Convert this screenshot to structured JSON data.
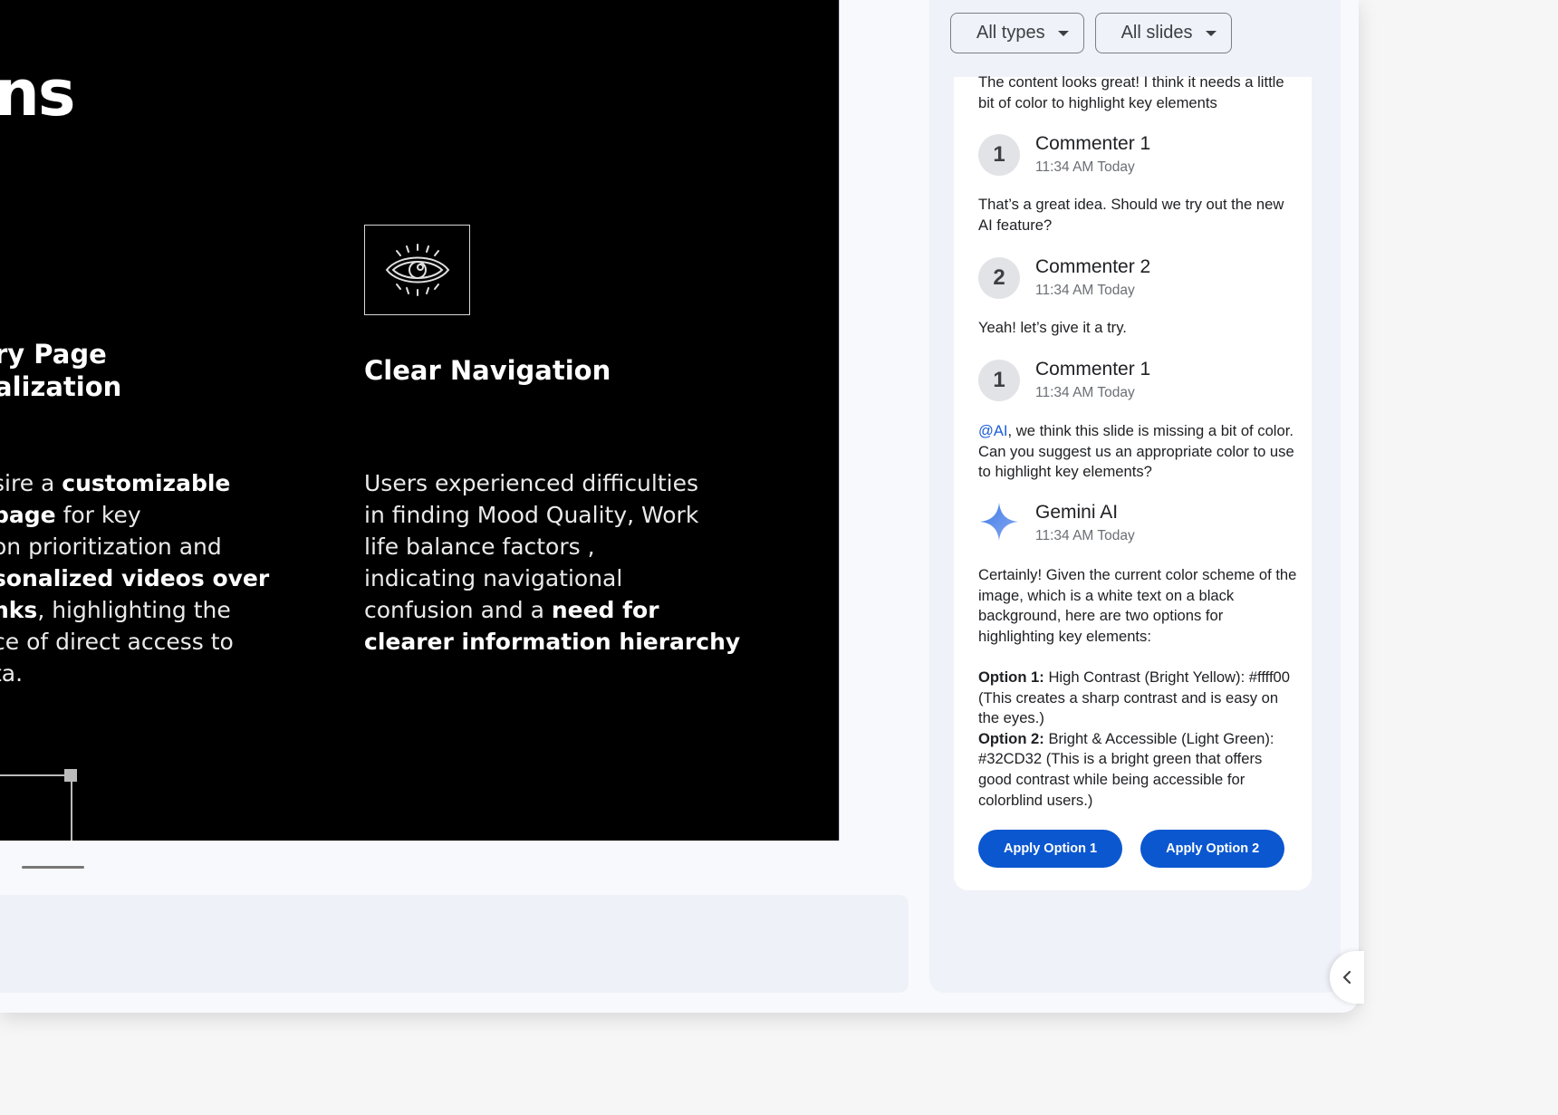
{
  "slide": {
    "title_fragment": "ns",
    "left_feature": {
      "heading_lines": [
        "ry Page",
        "alization"
      ],
      "body_lines": [
        [
          {
            "t": "sire a ",
            "b": false
          },
          {
            "t": "customizable",
            "b": true
          }
        ],
        [
          {
            "t": "page",
            "b": true
          },
          {
            "t": " for key",
            "b": false
          }
        ],
        [
          {
            "t": "on prioritization and",
            "b": false
          }
        ],
        [
          {
            "t": "sonalized videos over",
            "b": true
          }
        ],
        [
          {
            "t": "nks",
            "b": true
          },
          {
            "t": ", highlighting the",
            "b": false
          }
        ],
        [
          {
            "t": "ce of direct access to",
            "b": false
          }
        ],
        [
          {
            "t": "ta.",
            "b": false
          }
        ]
      ]
    },
    "right_feature": {
      "icon": "eye-icon",
      "heading": "Clear Navigation",
      "body_lines": [
        [
          {
            "t": "Users experienced difficulties",
            "b": false
          }
        ],
        [
          {
            "t": "in finding Mood Quality, Work",
            "b": false
          }
        ],
        [
          {
            "t": "life balance factors ,",
            "b": false
          }
        ],
        [
          {
            "t": "indicating navigational",
            "b": false
          }
        ],
        [
          {
            "t": "confusion and a ",
            "b": false
          },
          {
            "t": "need for",
            "b": true
          }
        ],
        [
          {
            "t": "clearer information hierarchy",
            "b": true
          }
        ]
      ]
    }
  },
  "comments_panel": {
    "filters": {
      "types": "All types",
      "slides": "All slides"
    },
    "thread": {
      "first_message": "The content looks great! I think it needs a little bit of color to highlight key elements",
      "entries": [
        {
          "avatar": "1",
          "author": "Commenter 1",
          "time": "11:34 AM Today",
          "message": "That’s a great idea. Should we try out the new AI feature?"
        },
        {
          "avatar": "2",
          "author": "Commenter 2",
          "time": "11:34 AM Today",
          "message": "Yeah! let’s give it a try."
        },
        {
          "avatar": "1",
          "author": "Commenter 1",
          "time": "11:34 AM Today",
          "mention": "@AI",
          "message": ", we think this slide is missing a bit of color. Can you suggest us an appropriate color to use to highlight key elements?"
        }
      ],
      "ai": {
        "author": "Gemini AI",
        "time": "11:34 AM Today",
        "intro": "Certainly! Given the current color scheme of the image, which is a white text on a black background, here are two options for highlighting key elements:",
        "option1_label": "Option 1:",
        "option1_text": " High Contrast (Bright Yellow): #ffff00 (This creates a sharp contrast and is easy on the eyes.)",
        "option2_label": "Option 2:",
        "option2_text": " Bright & Accessible (Light Green): #32CD32 (This is a bright green that offers good contrast while being accessible for colorblind users.)"
      },
      "buttons": {
        "apply1": "Apply Option 1",
        "apply2": "Apply Option 2"
      }
    }
  },
  "colors": {
    "accent": "#0b57d0",
    "mention": "#1a5dd8",
    "slide_bg": "#000000",
    "panel_bg": "#eff2f8"
  }
}
